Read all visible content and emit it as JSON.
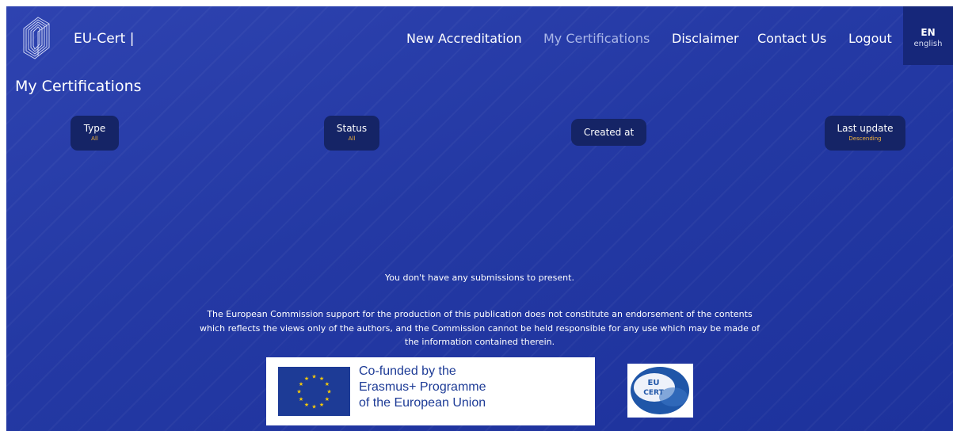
{
  "header": {
    "brand": "EU-Cert |",
    "nav": [
      {
        "label": "New Accreditation"
      },
      {
        "label": "My Certifications"
      },
      {
        "label": "Disclaimer"
      },
      {
        "label": "Contact Us"
      },
      {
        "label": "Logout"
      }
    ],
    "language": {
      "code": "EN",
      "name": "english"
    }
  },
  "page": {
    "title": "My Certifications",
    "filters": [
      {
        "label": "Type",
        "value": "All"
      },
      {
        "label": "Status",
        "value": "All"
      },
      {
        "label": "Created at"
      },
      {
        "label": "Last update",
        "value": "Descending"
      }
    ],
    "empty_message": "You don't have any submissions to present."
  },
  "footer": {
    "disclaimer": [
      "The European Commission support for the production of this publication does not constitute an endorsement of the contents",
      "which reflects the views only of the authors, and the Commission cannot be held responsible for any use which may be made of",
      "the information contained therein."
    ],
    "erasmus_lines": [
      "Co-funded by the",
      "Erasmus+ Programme",
      "of the European Union"
    ],
    "eucert_logo_text": [
      "EU",
      "CERT"
    ]
  },
  "colors": {
    "background": "#2439a4",
    "filter_pill": "#152466",
    "filter_value": "#f3b33d",
    "nav_active": "#aab6e8",
    "eu_blue": "#1d3b96",
    "eu_star": "#ffcc00"
  }
}
